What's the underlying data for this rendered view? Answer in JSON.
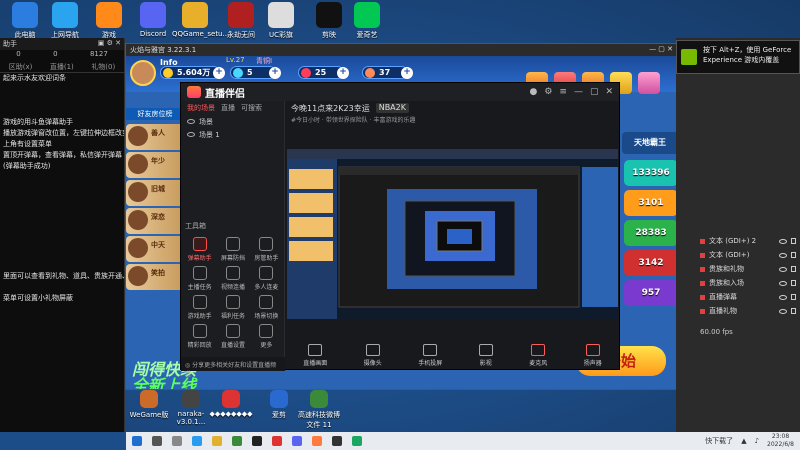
{
  "desktop": {
    "top_icons": [
      {
        "label": "此电脑",
        "color": "#2b7de0"
      },
      {
        "label": "上网导航",
        "color": "#2aa4ee"
      },
      {
        "label": "游戏",
        "color": "#ff8a1a"
      },
      {
        "label": "Discord",
        "color": "#5865f2"
      },
      {
        "label": "QQGame_setu...",
        "color": "#e8b02a"
      },
      {
        "label": "永劫无间",
        "color": "#b02020"
      },
      {
        "label": "UC彩旗",
        "color": "#dddddd"
      },
      {
        "label": "剪映",
        "color": "#111111"
      },
      {
        "label": "爱奇艺",
        "color": "#00c853"
      }
    ],
    "bottom_icons": [
      {
        "label": "WeGame版",
        "color": "#cc6a2a"
      },
      {
        "label": "naraka-v3.0.1...",
        "color": "#444444"
      },
      {
        "label": "◆◆◆◆◆◆◆◆",
        "color": "#d33"
      },
      {
        "label": "爱剪",
        "color": "#2a6ad0"
      },
      {
        "label": "高速科技微博文件 11",
        "color": "#3a8a3a"
      }
    ]
  },
  "leftpanel": {
    "title": "助手",
    "stats": [
      "0",
      "0",
      "8127"
    ],
    "tabs": [
      "区助(x)",
      "直播(1)",
      "礼物(0)"
    ],
    "messages": [
      "起来示水友欢迎词条",
      "",
      "",
      "",
      "游戏的用斗鱼弹幕助手",
      "播放游戏弹窗改位置，左键拉伸边框改变大小",
      "上角有设置菜单",
      "置顶开弹幕，查看弹幕，私信弹开弹幕",
      "(弹幕助手成功)",
      "",
      "",
      "",
      "",
      "",
      "",
      "",
      "",
      "",
      "里面可以查看到礼物、道具、贵族开通、钻粉开",
      "",
      "菜单可设置小礼物屏蔽"
    ]
  },
  "game": {
    "window_title": "火焰与雅宫 3.22.3.1",
    "player_name": "Info",
    "level": "Lv.27",
    "vip": "青铜I",
    "coins": "5.604万",
    "diamonds": "5",
    "hearts": "25",
    "candy": "37",
    "friends_tab": "好友房位榜",
    "friends": [
      "善人",
      "年少",
      "旧城",
      "深恋",
      "中天",
      "笑拍"
    ],
    "right_header": "天地霸王",
    "right_values": [
      "133396",
      "3101",
      "28383",
      "3142",
      "957"
    ],
    "right_colors": [
      "#19c3b0",
      "#ff9d1a",
      "#2bb24a",
      "#d03030",
      "#7a3ad0"
    ],
    "banner": "闯得快续",
    "banner2": "全新上线",
    "yellow_button": "开始"
  },
  "stream": {
    "app_name": "直播伴侣",
    "tabs": [
      "我的场景",
      "直播",
      "可搜索"
    ],
    "scenes": [
      "场景",
      "场景 1"
    ],
    "tools_label": "工具箱",
    "tools": [
      "弹幕助手",
      "屏幕防挡",
      "房管助手",
      "主播任务",
      "视频连播",
      "多人连麦",
      "游戏助手",
      "福利任务",
      "场景切换",
      "精彩回放",
      "直播设置",
      "更多"
    ],
    "footer": "◎ 分享更多相关好友和设置直播频道",
    "room_title": "今晚11点来2K23幸运",
    "room_tag": "NBA2K",
    "room_sub": "#今日小时 · 带领世界探险队 · 丰富游戏的乐趣",
    "bottom": [
      "直播画面",
      "摄像头",
      "手机投屏",
      "影视",
      "麦克风",
      "扬声器"
    ]
  },
  "overlay": {
    "gfx_line1": "按下 Alt+Z，使用 GeForce",
    "gfx_line2": "Experience 游戏内覆盖",
    "sources": [
      "文本 (GDI+) 2",
      "文本 (GDI+)",
      "贵族和礼物",
      "贵族和入场",
      "直播弹幕",
      "直播礼物"
    ],
    "fps": "60.00 fps"
  },
  "taskbar": {
    "tray_text": "快下载了",
    "time": "23:08",
    "date": "2022/6/8"
  }
}
